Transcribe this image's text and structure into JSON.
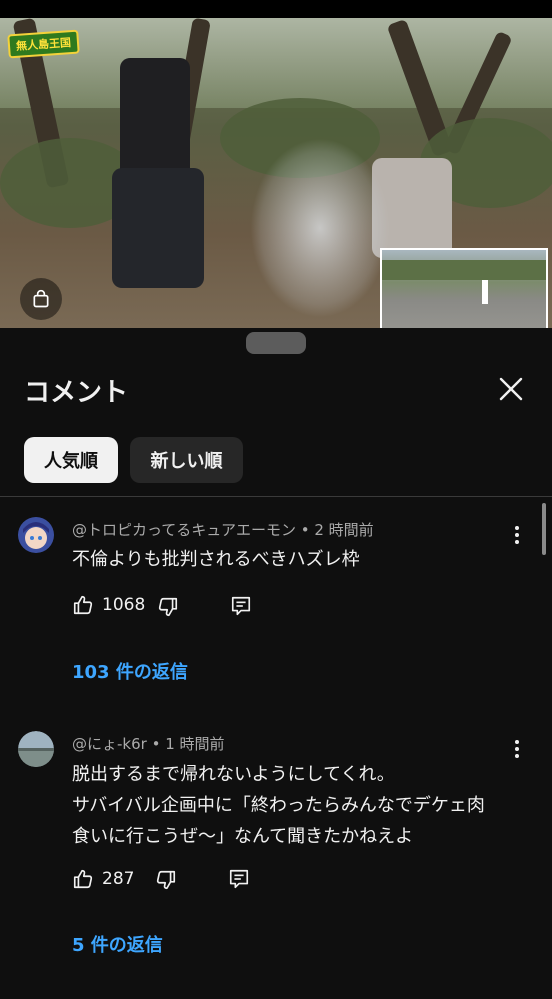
{
  "video": {
    "logo_text": "無人島王国",
    "shopping_icon": "shopping-bag-icon"
  },
  "sheet": {
    "title": "コメント",
    "close_icon": "close-icon",
    "sort_chips": [
      {
        "label": "人気順",
        "active": true
      },
      {
        "label": "新しい順",
        "active": false
      }
    ]
  },
  "comments": [
    {
      "author": "@トロピカってるキュアエーモン",
      "time": "2 時間前",
      "lines": [
        "不倫よりも批判されるべきハズレ枠"
      ],
      "likes": "1068",
      "replies": "103 件の返信"
    },
    {
      "author": "@にょ-k6r",
      "time": "1 時間前",
      "lines": [
        "脱出するまで帰れないようにしてくれ。",
        "サバイバル企画中に「終わったらみんなでデケェ肉",
        "食いに行こうぜ〜」なんて聞きたかねえよ"
      ],
      "likes": "287",
      "replies": "5 件の返信"
    }
  ],
  "colors": {
    "background": "#0f0f0f",
    "text": "#f1f1f1",
    "secondary_text": "#aaaaaa",
    "link": "#3ea6ff",
    "chip_inactive": "#272727"
  }
}
